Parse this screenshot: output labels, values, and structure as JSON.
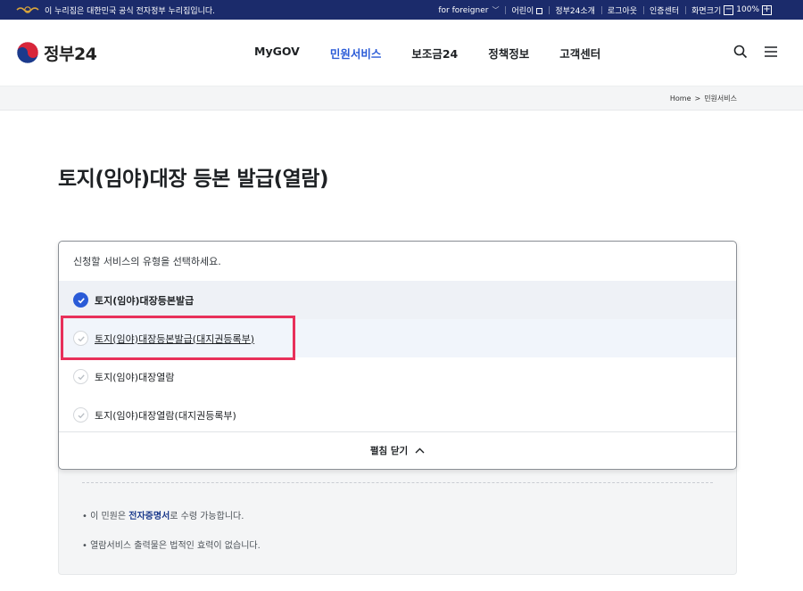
{
  "topbar": {
    "notice": "이 누리집은 대한민국 공식 전자정부 누리집입니다.",
    "foreigner": "for foreigner",
    "kids": "어린이",
    "intro": "정부24소개",
    "logout": "로그아웃",
    "cert": "인증센터",
    "zoom_label": "화면크기",
    "zoom_value": "100%",
    "zoom_minus": "−",
    "zoom_plus": "+"
  },
  "header": {
    "logo": "정부24",
    "nav": [
      "MyGOV",
      "민원서비스",
      "보조금24",
      "정책정보",
      "고객센터"
    ],
    "active_nav": "민원서비스"
  },
  "breadcrumb": {
    "home": "Home",
    "sep": ">",
    "current": "민원서비스"
  },
  "page": {
    "title": "토지(임야)대장 등본 발급(열람)"
  },
  "dropdown": {
    "prompt": "신청할 서비스의 유형을 선택하세요.",
    "options": [
      "토지(임야)대장등본발급",
      "토지(임야)대장등본발급(대지권등록부)",
      "토지(임야)대장열람",
      "토지(임야)대장열람(대지권등록부)"
    ],
    "selected_index": 0,
    "hover_index": 1,
    "collapse_label": "펼침 닫기"
  },
  "info": {
    "line1_prefix": "이 민원은 ",
    "line1_highlight": "전자증명서",
    "line1_suffix": "로 수령 가능합니다.",
    "line2": "열람서비스 출력물은 법적인 효력이 없습니다.",
    "bullet": "•"
  },
  "colors": {
    "brand_navy": "#1b2b6b",
    "accent_blue": "#2a5bd7",
    "highlight_red": "#e8305a"
  }
}
